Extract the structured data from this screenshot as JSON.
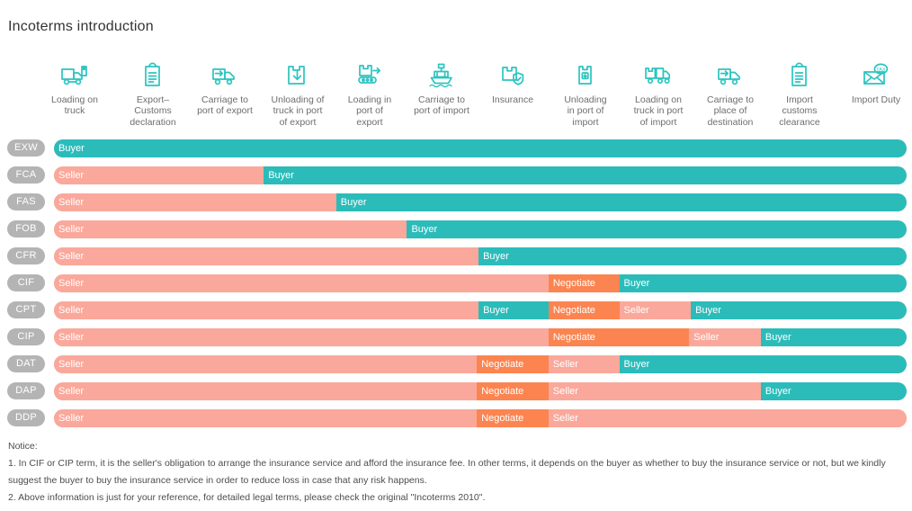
{
  "title": "Incoterms introduction",
  "colors": {
    "seller": "#faa89b",
    "buyer": "#2bbcba",
    "negotiate": "#fc8450",
    "badge": "#b4b4b4",
    "icon": "#2bc4c0",
    "text": "#4d4d4d"
  },
  "columns": [
    {
      "center": 83,
      "icon": "loading-on-truck-icon",
      "label": "Loading on\ntruck"
    },
    {
      "center": 170,
      "icon": "export-customs-clipboard-icon",
      "label": "Export–\nCustoms\ndeclaration"
    },
    {
      "center": 250,
      "icon": "carriage-truck-icon",
      "label": "Carriage to\nport of export"
    },
    {
      "center": 331,
      "icon": "unloading-box-down-icon",
      "label": "Unloading of\ntruck in port\nof export"
    },
    {
      "center": 411,
      "icon": "loading-conveyor-icon",
      "label": "Loading in\nport of\nexport"
    },
    {
      "center": 491,
      "icon": "ship-icon",
      "label": "Carriage to\nport of import"
    },
    {
      "center": 570,
      "icon": "insurance-shield-box-icon",
      "label": "Insurance"
    },
    {
      "center": 651,
      "icon": "unloading-port-box-icon",
      "label": "Unloading\nin port of\nimport"
    },
    {
      "center": 732,
      "icon": "loading-truck-port-icon",
      "label": "Loading on\ntruck in port\nof import"
    },
    {
      "center": 812,
      "icon": "carriage-destination-truck-icon",
      "label": "Carriage to\nplace of\ndestination"
    },
    {
      "center": 889,
      "icon": "import-customs-clipboard-icon",
      "label": "Import\ncustoms\nclearance"
    },
    {
      "center": 974,
      "icon": "import-duty-tax-icon",
      "label": "Import Duty"
    }
  ],
  "rows": [
    {
      "term": "EXW",
      "segments": [
        {
          "label": "Buyer",
          "type": "buyer",
          "start": 0,
          "end": 100
        }
      ]
    },
    {
      "term": "FCA",
      "segments": [
        {
          "label": "Seller",
          "type": "seller",
          "start": 0,
          "end": 24.6
        },
        {
          "label": "Buyer",
          "type": "buyer",
          "start": 24.6,
          "end": 100
        }
      ]
    },
    {
      "term": "FAS",
      "segments": [
        {
          "label": "Seller",
          "type": "seller",
          "start": 0,
          "end": 33.1
        },
        {
          "label": "Buyer",
          "type": "buyer",
          "start": 33.1,
          "end": 100
        }
      ]
    },
    {
      "term": "FOB",
      "segments": [
        {
          "label": "Seller",
          "type": "seller",
          "start": 0,
          "end": 41.4
        },
        {
          "label": "Buyer",
          "type": "buyer",
          "start": 41.4,
          "end": 100
        }
      ]
    },
    {
      "term": "CFR",
      "segments": [
        {
          "label": "Seller",
          "type": "seller",
          "start": 0,
          "end": 49.8
        },
        {
          "label": "Buyer",
          "type": "buyer",
          "start": 49.8,
          "end": 100
        }
      ]
    },
    {
      "term": "CIF",
      "segments": [
        {
          "label": "Seller",
          "type": "seller",
          "start": 0,
          "end": 58.0
        },
        {
          "label": "Negotiate",
          "type": "negotiate",
          "start": 58.0,
          "end": 66.3
        },
        {
          "label": "Buyer",
          "type": "buyer",
          "start": 66.3,
          "end": 100
        }
      ]
    },
    {
      "term": "CPT",
      "segments": [
        {
          "label": "Seller",
          "type": "seller",
          "start": 0,
          "end": 49.8
        },
        {
          "label": "Buyer",
          "type": "buyer",
          "start": 49.8,
          "end": 58.0
        },
        {
          "label": "Negotiate",
          "type": "negotiate",
          "start": 58.0,
          "end": 66.3
        },
        {
          "label": "Seller",
          "type": "seller",
          "start": 66.3,
          "end": 74.7
        },
        {
          "label": "Buyer",
          "type": "buyer",
          "start": 74.7,
          "end": 100
        }
      ]
    },
    {
      "term": "CIP",
      "segments": [
        {
          "label": "Seller",
          "type": "seller",
          "start": 0,
          "end": 58.0
        },
        {
          "label": "Negotiate",
          "type": "negotiate",
          "start": 58.0,
          "end": 74.5
        },
        {
          "label": "Seller",
          "type": "seller",
          "start": 74.5,
          "end": 82.9
        },
        {
          "label": "Buyer",
          "type": "buyer",
          "start": 82.9,
          "end": 100
        }
      ]
    },
    {
      "term": "DAT",
      "segments": [
        {
          "label": "Seller",
          "type": "seller",
          "start": 0,
          "end": 49.6
        },
        {
          "label": "Negotiate",
          "type": "negotiate",
          "start": 49.6,
          "end": 58.0
        },
        {
          "label": "Seller",
          "type": "seller",
          "start": 58.0,
          "end": 66.3
        },
        {
          "label": "Buyer",
          "type": "buyer",
          "start": 66.3,
          "end": 100
        }
      ]
    },
    {
      "term": "DAP",
      "segments": [
        {
          "label": "Seller",
          "type": "seller",
          "start": 0,
          "end": 49.6
        },
        {
          "label": "Negotiate",
          "type": "negotiate",
          "start": 49.6,
          "end": 58.0
        },
        {
          "label": "Seller",
          "type": "seller",
          "start": 58.0,
          "end": 82.9
        },
        {
          "label": "Buyer",
          "type": "buyer",
          "start": 82.9,
          "end": 100
        }
      ]
    },
    {
      "term": "DDP",
      "segments": [
        {
          "label": "Seller",
          "type": "seller",
          "start": 0,
          "end": 49.6
        },
        {
          "label": "Negotiate",
          "type": "negotiate",
          "start": 49.6,
          "end": 58.0
        },
        {
          "label": "Seller",
          "type": "seller",
          "start": 58.0,
          "end": 100
        }
      ]
    }
  ],
  "notice": {
    "heading": "Notice:",
    "line1": "1. In CIF or CIP term, it is the seller's obligation to arrange the insurance service and afford the insurance fee. In other terms, it depends on the buyer as whether to buy the insurance service or not, but we kindly suggest the buyer to buy the insurance service in order to reduce loss in case that any risk happens.",
    "line2": "2. Above information is just for your reference, for detailed legal terms, please check the original \"Incoterms 2010\"."
  }
}
